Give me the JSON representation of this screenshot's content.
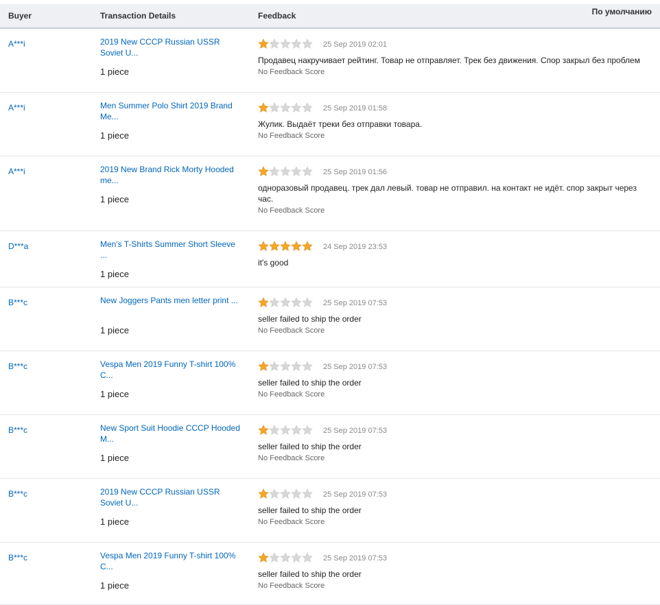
{
  "table": {
    "headers": {
      "buyer": "Buyer",
      "transaction": "Transaction Details",
      "feedback": "Feedback"
    },
    "sort_label": "По умолчанию",
    "colors": {
      "link": "#0066bb",
      "star_filled": "#f5a623",
      "star_empty": "#d7d7d7"
    },
    "rows": [
      {
        "buyer": "A***i",
        "product": "2019 New CCCP Russian USSR Soviet U...",
        "qty": "1 piece",
        "rating": 1,
        "date": "25 Sep 2019 02:01",
        "text": "Продавец накручивает рейтинг. Товар не отправляет. Трек без движения. Спор закрыл без проблем",
        "score": "No Feedback Score"
      },
      {
        "buyer": "A***i",
        "product": "Men Summer Polo Shirt 2019 Brand Me...",
        "qty": "1 piece",
        "rating": 1,
        "date": "25 Sep 2019 01:58",
        "text": "Жулик. Выдаёт треки без отправки товара.",
        "score": "No Feedback Score"
      },
      {
        "buyer": "A***i",
        "product": "2019 New Brand Rick Morty Hooded me...",
        "qty": "1 piece",
        "rating": 1,
        "date": "25 Sep 2019 01:56",
        "text": "одноразовый продавец. трек дал левый. товар не отправил. на контакт не идёт. спор закрыт через час.",
        "score": "No Feedback Score"
      },
      {
        "buyer": "D***a",
        "product": "Men's T-Shirts Summer Short Sleeve ...",
        "qty": "1 piece",
        "rating": 5,
        "date": "24 Sep 2019 23:53",
        "text": "it's good",
        "score": ""
      },
      {
        "buyer": "B***c",
        "product": "New Joggers Pants men letter print ...",
        "qty": "1 piece",
        "rating": 1,
        "date": "25 Sep 2019 07:53",
        "text": "seller failed to ship the order",
        "score": "No Feedback Score"
      },
      {
        "buyer": "B***c",
        "product": "Vespa Men 2019 Funny T-shirt 100% C...",
        "qty": "1 piece",
        "rating": 1,
        "date": "25 Sep 2019 07:53",
        "text": "seller failed to ship the order",
        "score": "No Feedback Score"
      },
      {
        "buyer": "B***c",
        "product": "New Sport Suit Hoodie CCCP Hooded M...",
        "qty": "1 piece",
        "rating": 1,
        "date": "25 Sep 2019 07:53",
        "text": "seller failed to ship the order",
        "score": "No Feedback Score"
      },
      {
        "buyer": "B***c",
        "product": "2019 New CCCP Russian USSR Soviet U...",
        "qty": "1 piece",
        "rating": 1,
        "date": "25 Sep 2019 07:53",
        "text": "seller failed to ship the order",
        "score": "No Feedback Score"
      },
      {
        "buyer": "B***c",
        "product": "Vespa Men 2019 Funny T-shirt 100% C...",
        "qty": "1 piece",
        "rating": 1,
        "date": "25 Sep 2019 07:53",
        "text": "seller failed to ship the order",
        "score": "No Feedback Score"
      }
    ]
  }
}
